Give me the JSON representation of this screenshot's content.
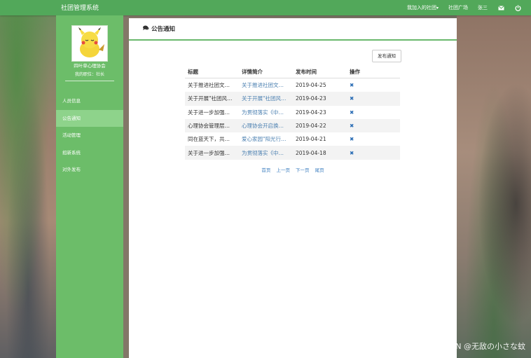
{
  "topbar": {
    "brand": "社团管理系统",
    "my_clubs": "我加入的社团",
    "square": "社团广场",
    "user": "张三",
    "mail_icon": "envelope-icon",
    "logout_icon": "power-icon"
  },
  "sidebar": {
    "org_name": "四叶草心理协会",
    "role": "我的职位：社长",
    "menu": [
      {
        "label": "人员信息"
      },
      {
        "label": "公告通知",
        "active": true
      },
      {
        "label": "活动管理"
      },
      {
        "label": "招新系统"
      },
      {
        "label": "对外发布"
      }
    ]
  },
  "main": {
    "title": "公告通知",
    "title_icon": "comments-icon",
    "publish_label": "发布通知",
    "columns": [
      "标题",
      "详情简介",
      "发布时间",
      "操作"
    ],
    "rows": [
      {
        "title": "关于推进社团文…",
        "intro": "关于推进社团文…",
        "date": "2019-04-25",
        "action": "✖"
      },
      {
        "title": "关于开展\"社团风…",
        "intro": "关于开展\"社团风…",
        "date": "2019-04-23",
        "action": "✖"
      },
      {
        "title": "关于进一步加强…",
        "intro": "为贯彻落实《中…",
        "date": "2019-04-23",
        "action": "✖"
      },
      {
        "title": "心理协会管理层…",
        "intro": "心理协会开启换…",
        "date": "2019-04-22",
        "action": "✖"
      },
      {
        "title": "同在蓝天下，共…",
        "intro": "爱心家园\"阳光行…",
        "date": "2019-04-21",
        "action": "✖"
      },
      {
        "title": "关于进一步加强…",
        "intro": "为贯彻落实《中…",
        "date": "2019-04-18",
        "action": "✖"
      }
    ],
    "pager": {
      "first": "首页",
      "prev": "上一页",
      "next": "下一页",
      "last": "尾页"
    }
  },
  "watermark": "CSDN @无敌の小さな蚊",
  "colors": {
    "topbar": "#52a85a",
    "sidebar": "#6cbd69",
    "active": "#8ed38b",
    "link": "#3e7fc0"
  }
}
